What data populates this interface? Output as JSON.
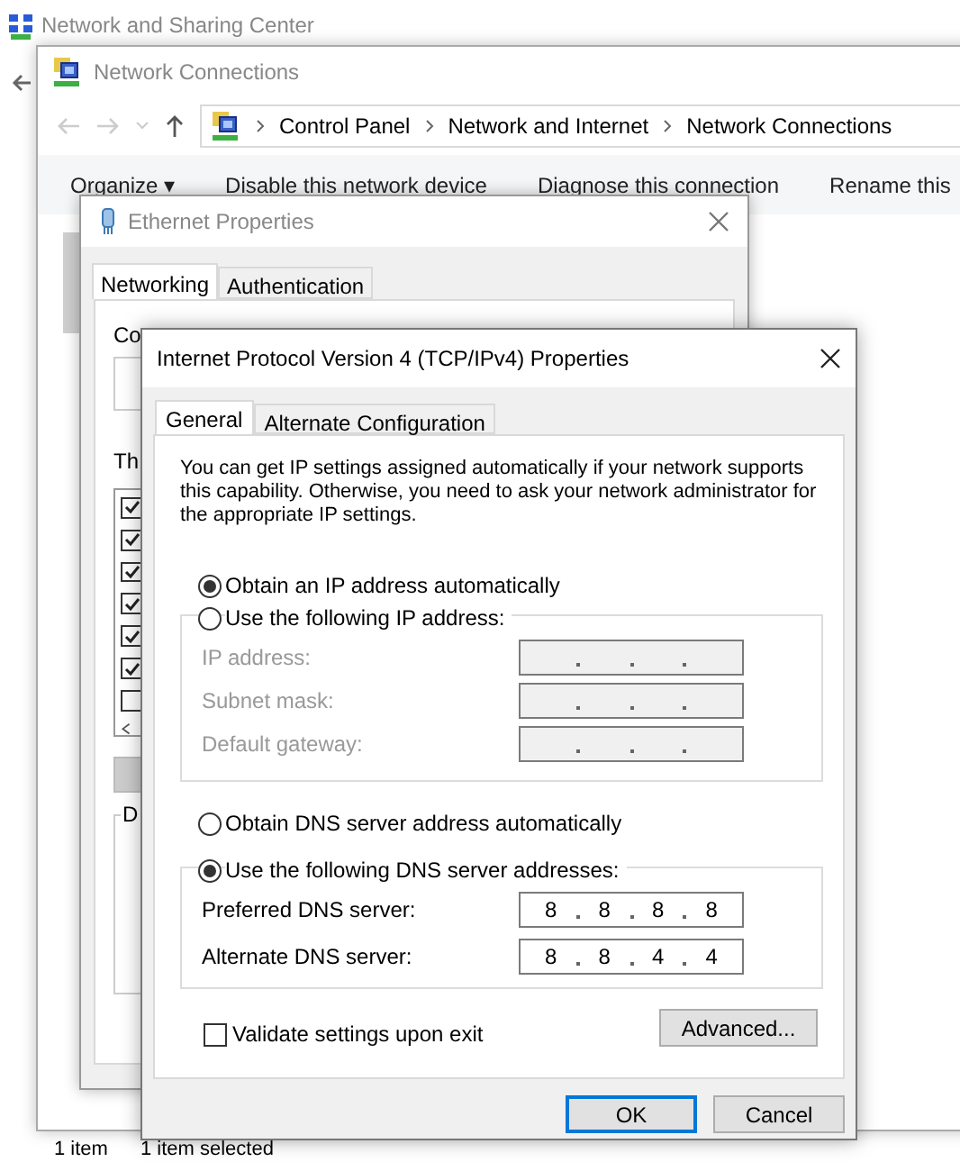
{
  "background_window": {
    "title": "Network and Sharing Center",
    "status_bar": [
      "1 item",
      "1 item selected"
    ]
  },
  "network_connections": {
    "title": "Network Connections",
    "breadcrumb": [
      "Control Panel",
      "Network and Internet",
      "Network Connections"
    ],
    "toolbar": [
      "Organize ▾",
      "Disable this network device",
      "Diagnose this connection",
      "Rename this"
    ]
  },
  "ethernet_properties": {
    "title": "Ethernet Properties",
    "tabs": [
      {
        "label": "Networking",
        "selected": true
      },
      {
        "label": "Authentication",
        "selected": false
      }
    ],
    "partial_labels": [
      "Co",
      "Th"
    ],
    "items": [
      {
        "checked": true
      },
      {
        "checked": true
      },
      {
        "checked": true
      },
      {
        "checked": true
      },
      {
        "checked": true
      },
      {
        "checked": true
      },
      {
        "checked": false
      }
    ],
    "group_label": "D"
  },
  "ipv4_properties": {
    "title": "Internet Protocol Version 4 (TCP/IPv4) Properties",
    "tabs": [
      {
        "label": "General",
        "selected": true
      },
      {
        "label": "Alternate Configuration",
        "selected": false
      }
    ],
    "description": "You can get IP settings assigned automatically if your network supports this capability. Otherwise, you need to ask your network administrator for the appropriate IP settings.",
    "ip_mode": [
      {
        "label": "Obtain an IP address automatically",
        "selected": true
      },
      {
        "label": "Use the following IP address:",
        "selected": false
      }
    ],
    "ip_fields": [
      {
        "label": "IP address:",
        "disabled": true
      },
      {
        "label": "Subnet mask:",
        "disabled": true
      },
      {
        "label": "Default gateway:",
        "disabled": true
      }
    ],
    "dns_mode": [
      {
        "label": "Obtain DNS server address automatically",
        "selected": false
      },
      {
        "label": "Use the following DNS server addresses:",
        "selected": true
      }
    ],
    "dns_fields": [
      {
        "label": "Preferred DNS server:",
        "disabled": false,
        "octets": [
          "8",
          "8",
          "8",
          "8"
        ]
      },
      {
        "label": "Alternate DNS server:",
        "disabled": false,
        "octets": [
          "8",
          "8",
          "4",
          "4"
        ]
      }
    ],
    "validate": {
      "label": "Validate settings upon exit",
      "checked": false
    },
    "advanced_button": "Advanced...",
    "buttons": [
      "OK",
      "Cancel"
    ]
  }
}
